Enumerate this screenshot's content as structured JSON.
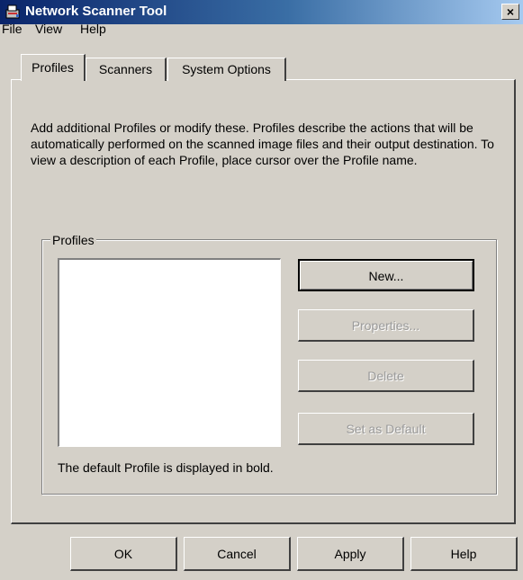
{
  "window": {
    "title": "Network Scanner Tool",
    "close_label": "×"
  },
  "menu": {
    "items": [
      "File",
      "View",
      "Help"
    ]
  },
  "tabs": [
    {
      "label": "Profiles",
      "active": true
    },
    {
      "label": "Scanners",
      "active": false
    },
    {
      "label": "System Options",
      "active": false
    }
  ],
  "profiles_tab": {
    "description": "Add additional Profiles or modify these. Profiles describe the actions that will be automatically performed on the scanned image files and their output destination. To view a description of each  Profile, place cursor over the Profile name.",
    "group_label": "Profiles",
    "buttons": {
      "new": "New...",
      "properties": "Properties...",
      "delete": "Delete",
      "set_default": "Set as Default"
    },
    "footnote": "The default Profile is displayed in bold.",
    "profiles_list": []
  },
  "dialog_buttons": {
    "ok": "OK",
    "cancel": "Cancel",
    "apply": "Apply",
    "help": "Help"
  },
  "colors": {
    "titlebar_start": "#0a246a",
    "titlebar_end": "#a6caf0",
    "face": "#d4d0c8",
    "disabled_text": "#9a9a9a"
  },
  "icons": {
    "title": "scanner-app-icon",
    "close": "close-icon"
  }
}
